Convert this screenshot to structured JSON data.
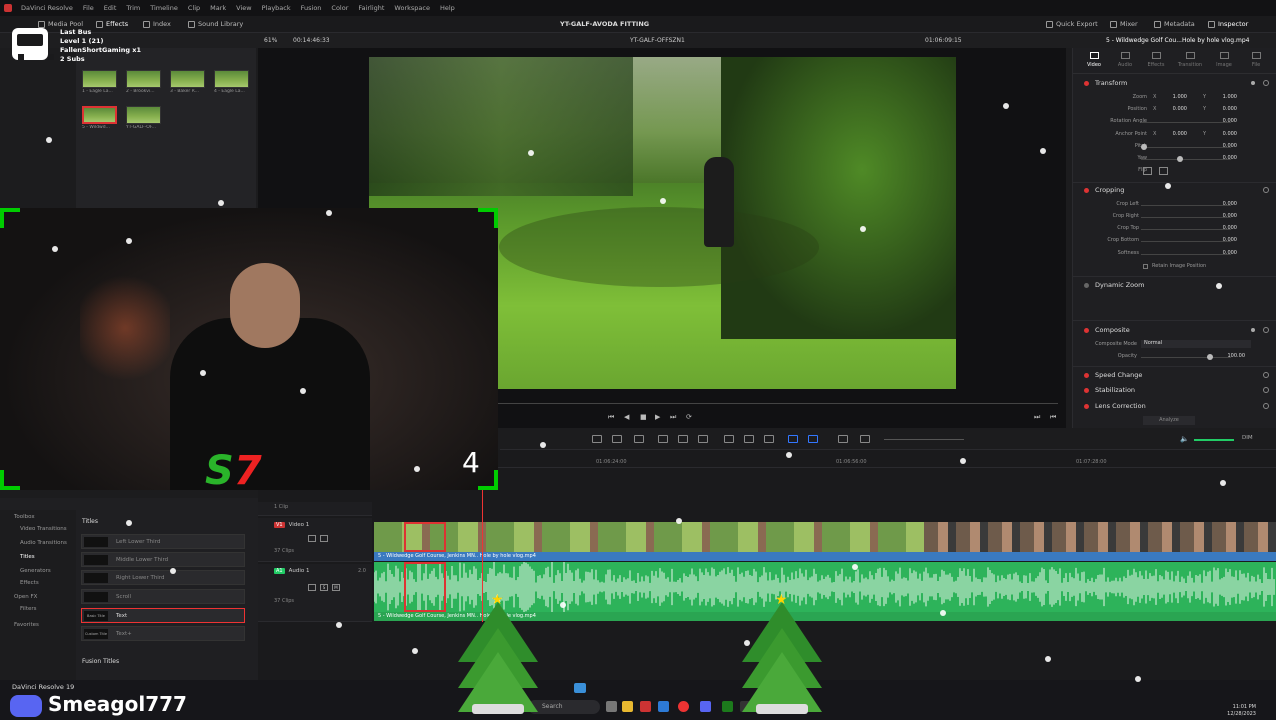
{
  "menubar": {
    "app": "DaVinci Resolve",
    "items": [
      "File",
      "Edit",
      "Trim",
      "Timeline",
      "Clip",
      "Mark",
      "View",
      "Playback",
      "Fusion",
      "Color",
      "Fairlight",
      "Workspace",
      "Help"
    ]
  },
  "toolbar": {
    "media_pool": "Media Pool",
    "effects": "Effects",
    "index": "Index",
    "sound_library": "Sound Library",
    "project_title": "YT-GALF-AVODA FITTING",
    "quick_export": "Quick Export",
    "mixer": "Mixer",
    "metadata": "Metadata",
    "inspector": "Inspector"
  },
  "viewer_info": {
    "zoom": "61%",
    "duration": "00:14:46:33",
    "timeline_name": "YT-GALF-OFFSZN1",
    "timecode": "01:06:09:15",
    "clip_name": "5 - Wildwedge Golf Cou...Hole by hole vlog.mp4"
  },
  "stream_overlay": {
    "line1": "Last Bus",
    "line2": "Level 1 (21)",
    "line3": "FallenShortGaming x1",
    "line4": "2 Subs"
  },
  "media_pool": {
    "clips": [
      {
        "label": "1 - Eagle La..."
      },
      {
        "label": "2 - Brookvi..."
      },
      {
        "label": "3 - Baker R..."
      },
      {
        "label": "4 - Eagle La..."
      },
      {
        "label": "5 - Wildwd..."
      },
      {
        "label": "YT-GALF-OF..."
      }
    ]
  },
  "inspector": {
    "tabs": [
      "Video",
      "Audio",
      "Effects",
      "Transition",
      "Image",
      "File"
    ],
    "transform": {
      "title": "Transform",
      "zoom_label": "Zoom",
      "zoom_x": "1.000",
      "zoom_y": "1.000",
      "position_label": "Position",
      "position_x": "0.000",
      "position_y": "0.000",
      "rotation_label": "Rotation Angle",
      "rotation": "0.000",
      "anchor_label": "Anchor Point",
      "anchor_x": "0.000",
      "anchor_y": "0.000",
      "pitch_label": "Pitch",
      "pitch": "0.000",
      "yaw_label": "Yaw",
      "yaw": "0.000",
      "flip_label": "Flip"
    },
    "cropping": {
      "title": "Cropping",
      "crop_left_label": "Crop Left",
      "crop_left": "0.000",
      "crop_right_label": "Crop Right",
      "crop_right": "0.000",
      "crop_top_label": "Crop Top",
      "crop_top": "0.000",
      "crop_bottom_label": "Crop Bottom",
      "crop_bottom": "0.000",
      "softness_label": "Softness",
      "softness": "0.000",
      "retain_label": "Retain Image Position"
    },
    "dynamic_zoom": "Dynamic Zoom",
    "composite": {
      "title": "Composite",
      "mode_label": "Composite Mode",
      "mode": "Normal",
      "opacity_label": "Opacity",
      "opacity": "100.00"
    },
    "speed_change": "Speed Change",
    "stabilization": "Stabilization",
    "lens_correction": "Lens Correction",
    "analyze": "Analyze"
  },
  "effects_panel": {
    "tree": [
      "Toolbox",
      "Video Transitions",
      "Audio Transitions",
      "Titles",
      "Generators",
      "Effects",
      "Open FX",
      "Filters",
      "Favorites"
    ],
    "section": "Titles",
    "items": [
      {
        "thumb": "",
        "name": "Left Lower Third"
      },
      {
        "thumb": "",
        "name": "Middle Lower Third"
      },
      {
        "thumb": "",
        "name": "Right Lower Third"
      },
      {
        "thumb": "",
        "name": "Scroll"
      },
      {
        "thumb": "Basic Title",
        "name": "Text"
      },
      {
        "thumb": "Custom Title",
        "name": "Text+"
      }
    ],
    "fusion_section": "Fusion Titles"
  },
  "timeline": {
    "ruler": [
      "01:06:24:00",
      "01:06:56:00",
      "01:07:28:00"
    ],
    "top_track_clips": "1 Clip",
    "video_track": {
      "badge": "V1",
      "name": "Video 1",
      "clips": "37 Clips"
    },
    "audio_track": {
      "badge": "A1",
      "name": "Audio 1",
      "level": "2.0",
      "clips": "37 Clips"
    },
    "video_clip_label": "5 - Wildwedge Golf Course, Jenkins MN.. Hole by hole vlog.mp4",
    "audio_clip_label": "5 - Wildwedge Golf Course, Jenkins MN.. Hole by hole vlog.mp4",
    "dim": "DIM"
  },
  "webcam": {
    "count": "4"
  },
  "taskbar": {
    "resolve_label": "DaVinci Resolve 19",
    "username": "Smeagol777",
    "search": "Search",
    "time": "11:01 PM",
    "date": "12/28/2023"
  },
  "colors": {
    "accent_red": "#d33333",
    "audio_green": "#2db35a",
    "video_blue": "#3a7ac0"
  }
}
